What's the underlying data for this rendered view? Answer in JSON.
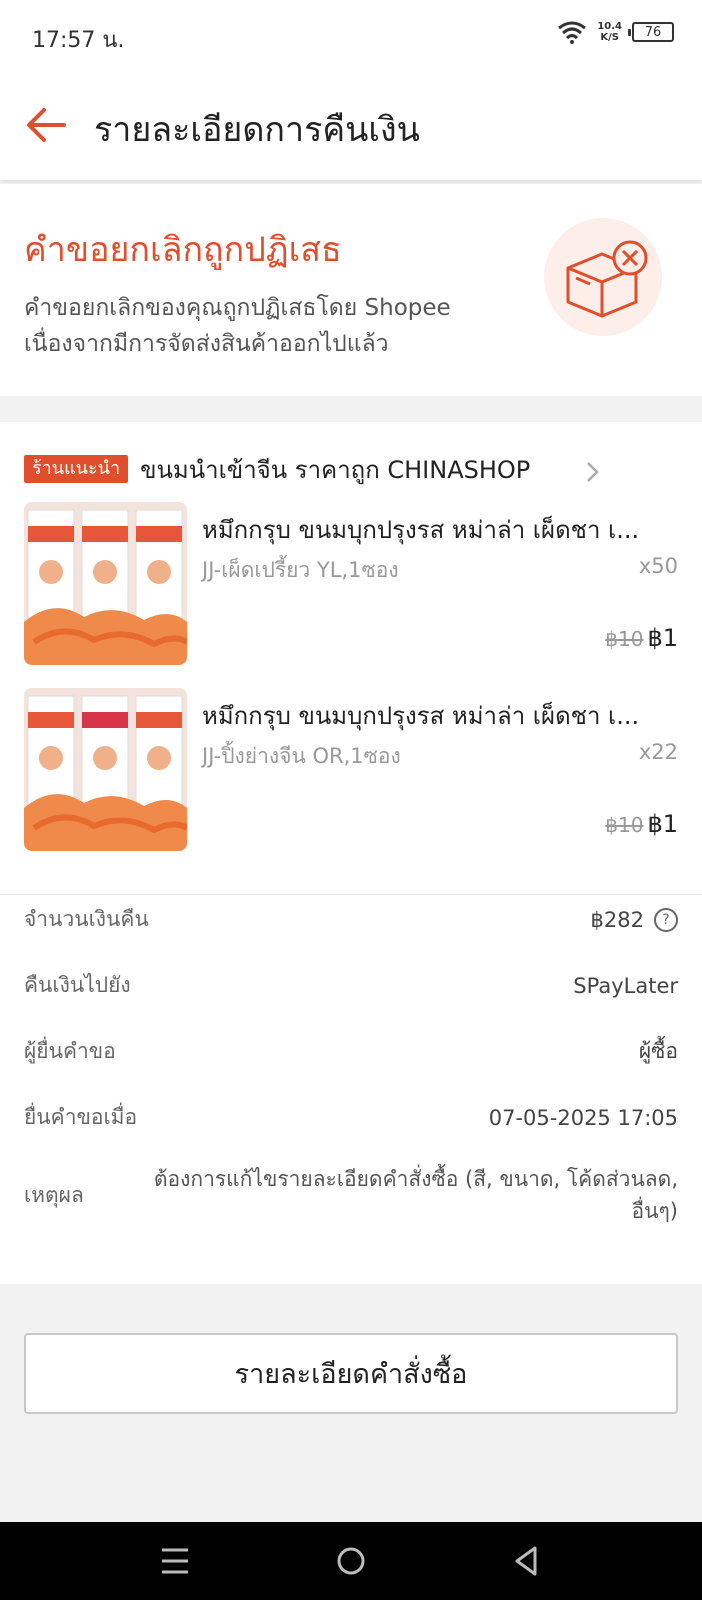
{
  "status": {
    "time": "17:57 น.",
    "speed_value": "10.4",
    "speed_unit": "K/S",
    "battery": "76",
    "icons": [
      "wifi-icon",
      "battery-icon"
    ]
  },
  "header": {
    "title": "รายละเอียดการคืนเงิน",
    "back_icon": "arrow-left-icon"
  },
  "banner": {
    "heading": "คำขอยกเลิกถูกปฏิเสธ",
    "line1": "คำขอยกเลิกของคุณถูกปฏิเสธโดย Shopee",
    "line2": "เนื่องจากมีการจัดส่งสินค้าออกไปแล้ว",
    "illustration_icon": "box-cancel-icon"
  },
  "shop": {
    "badge": "ร้านแนะนำ",
    "name": "ขนมนำเข้าจีน ราคาถูก CHINASHOP",
    "chevron_icon": "chevron-right-icon"
  },
  "items": [
    {
      "name": "หมึกกรุบ ขนมบุกปรุงรส หม่าล่า เผ็ดชา เ...",
      "variant": "JJ-เผ็ดเปรี้ยว YL,1ซอง",
      "qty": "x50",
      "old_price": "฿10",
      "price": "฿1"
    },
    {
      "name": "หมึกกรุบ ขนมบุกปรุงรส หม่าล่า เผ็ดชา เ...",
      "variant": "JJ-ปิ้งย่างจีน OR,1ซอง",
      "qty": "x22",
      "old_price": "฿10",
      "price": "฿1"
    }
  ],
  "details": {
    "refund_amount_label": "จำนวนเงินคืน",
    "refund_amount_value": "฿282",
    "refund_to_label": "คืนเงินไปยัง",
    "refund_to_value": "SPayLater",
    "requester_label": "ผู้ยื่นคำขอ",
    "requester_value": "ผู้ซื้อ",
    "requested_at_label": "ยื่นคำขอเมื่อ",
    "requested_at_value": "07-05-2025 17:05",
    "reason_label": "เหตุผล",
    "reason_value_line1": "ต้องการแก้ไขรายละเอียดคำสั่งซื้อ (สี, ขนาด, โค้ดส่วนลด,",
    "reason_value_line2": "อื่นๆ)",
    "help_symbol": "?"
  },
  "actions": {
    "order_details_button": "รายละเอียดคำสั่งซื้อ"
  },
  "navbar": {
    "icons": [
      "menu-icon",
      "home-circle-icon",
      "back-triangle-icon"
    ]
  },
  "colors": {
    "accent": "#e04e2c",
    "banner_bg_circle": "#fdeee9",
    "page_bg": "#f2f2f2"
  }
}
